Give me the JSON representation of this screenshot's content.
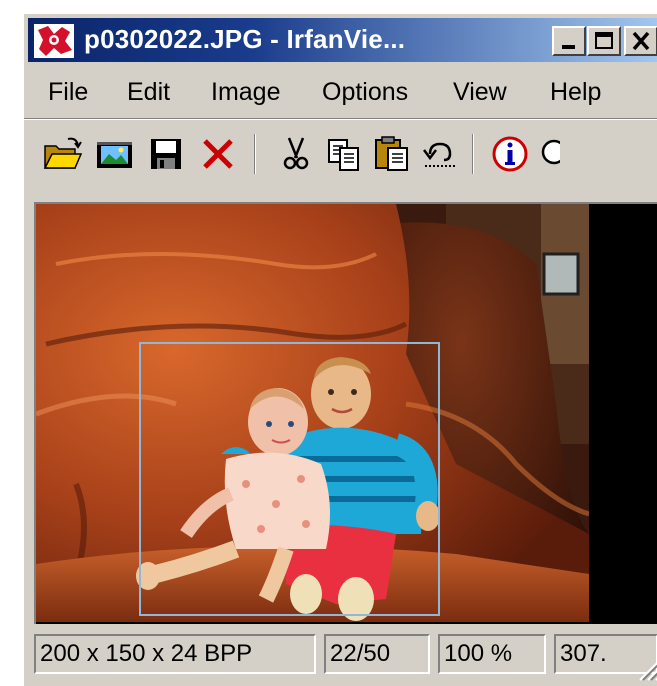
{
  "window": {
    "title": "p0302022.JPG - IrfanVie...",
    "controls": {
      "minimize": "minimize",
      "maximize": "maximize",
      "close": "close"
    }
  },
  "menu": [
    "File",
    "Edit",
    "Image",
    "Options",
    "View",
    "Help"
  ],
  "toolbar": {
    "icons": [
      "open-folder-icon",
      "slideshow-icon",
      "save-icon",
      "delete-icon",
      "cut-icon",
      "copy-icon",
      "paste-icon",
      "undo-icon",
      "info-icon"
    ]
  },
  "viewer": {
    "image_description_icon": "photo-of-two-dolls-on-leather-armchair",
    "selection": true
  },
  "status": {
    "dimensions": "200 x 150 x 24 BPP",
    "position": "22/50",
    "zoom": "100 %",
    "size": "307."
  },
  "colors": {
    "titlebar_start": "#0a246a",
    "titlebar_end": "#a6caf0",
    "chrome": "#d4d0c8",
    "delete_red": "#cc0000",
    "selection_border": "#8fb8d8"
  }
}
